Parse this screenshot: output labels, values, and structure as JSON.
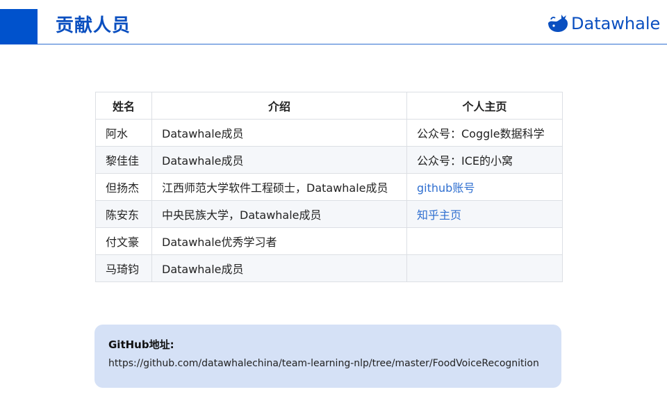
{
  "header": {
    "title": "贡献人员",
    "logo_text": "Datawhale",
    "logo_icon": "whale-icon"
  },
  "table": {
    "headers": [
      "姓名",
      "介绍",
      "个人主页"
    ],
    "rows": [
      {
        "name": "阿水",
        "intro": "Datawhale成员",
        "home": "公众号：Coggle数据科学",
        "home_is_link": false
      },
      {
        "name": "黎佳佳",
        "intro": "Datawhale成员",
        "home": "公众号：ICE的小窝",
        "home_is_link": false
      },
      {
        "name": "但扬杰",
        "intro": "江西师范大学软件工程硕士，Datawhale成员",
        "home": "github账号",
        "home_is_link": true
      },
      {
        "name": "陈安东",
        "intro": "中央民族大学，Datawhale成员",
        "home": "知乎主页",
        "home_is_link": true
      },
      {
        "name": "付文豪",
        "intro": "Datawhale优秀学习者",
        "home": "",
        "home_is_link": false
      },
      {
        "name": "马琦钧",
        "intro": "Datawhale成员",
        "home": "",
        "home_is_link": false
      }
    ]
  },
  "info": {
    "label": "GitHub地址:",
    "url": "https://github.com/datawhalechina/team-learning-nlp/tree/master/FoodVoiceRecognition"
  },
  "colors": {
    "brand_blue": "#0052cc",
    "title_blue": "#0a4fc0",
    "link_blue": "#2f6fd0",
    "info_box_bg": "#d5e1f6",
    "row_alt_bg": "#f5f7fa"
  }
}
